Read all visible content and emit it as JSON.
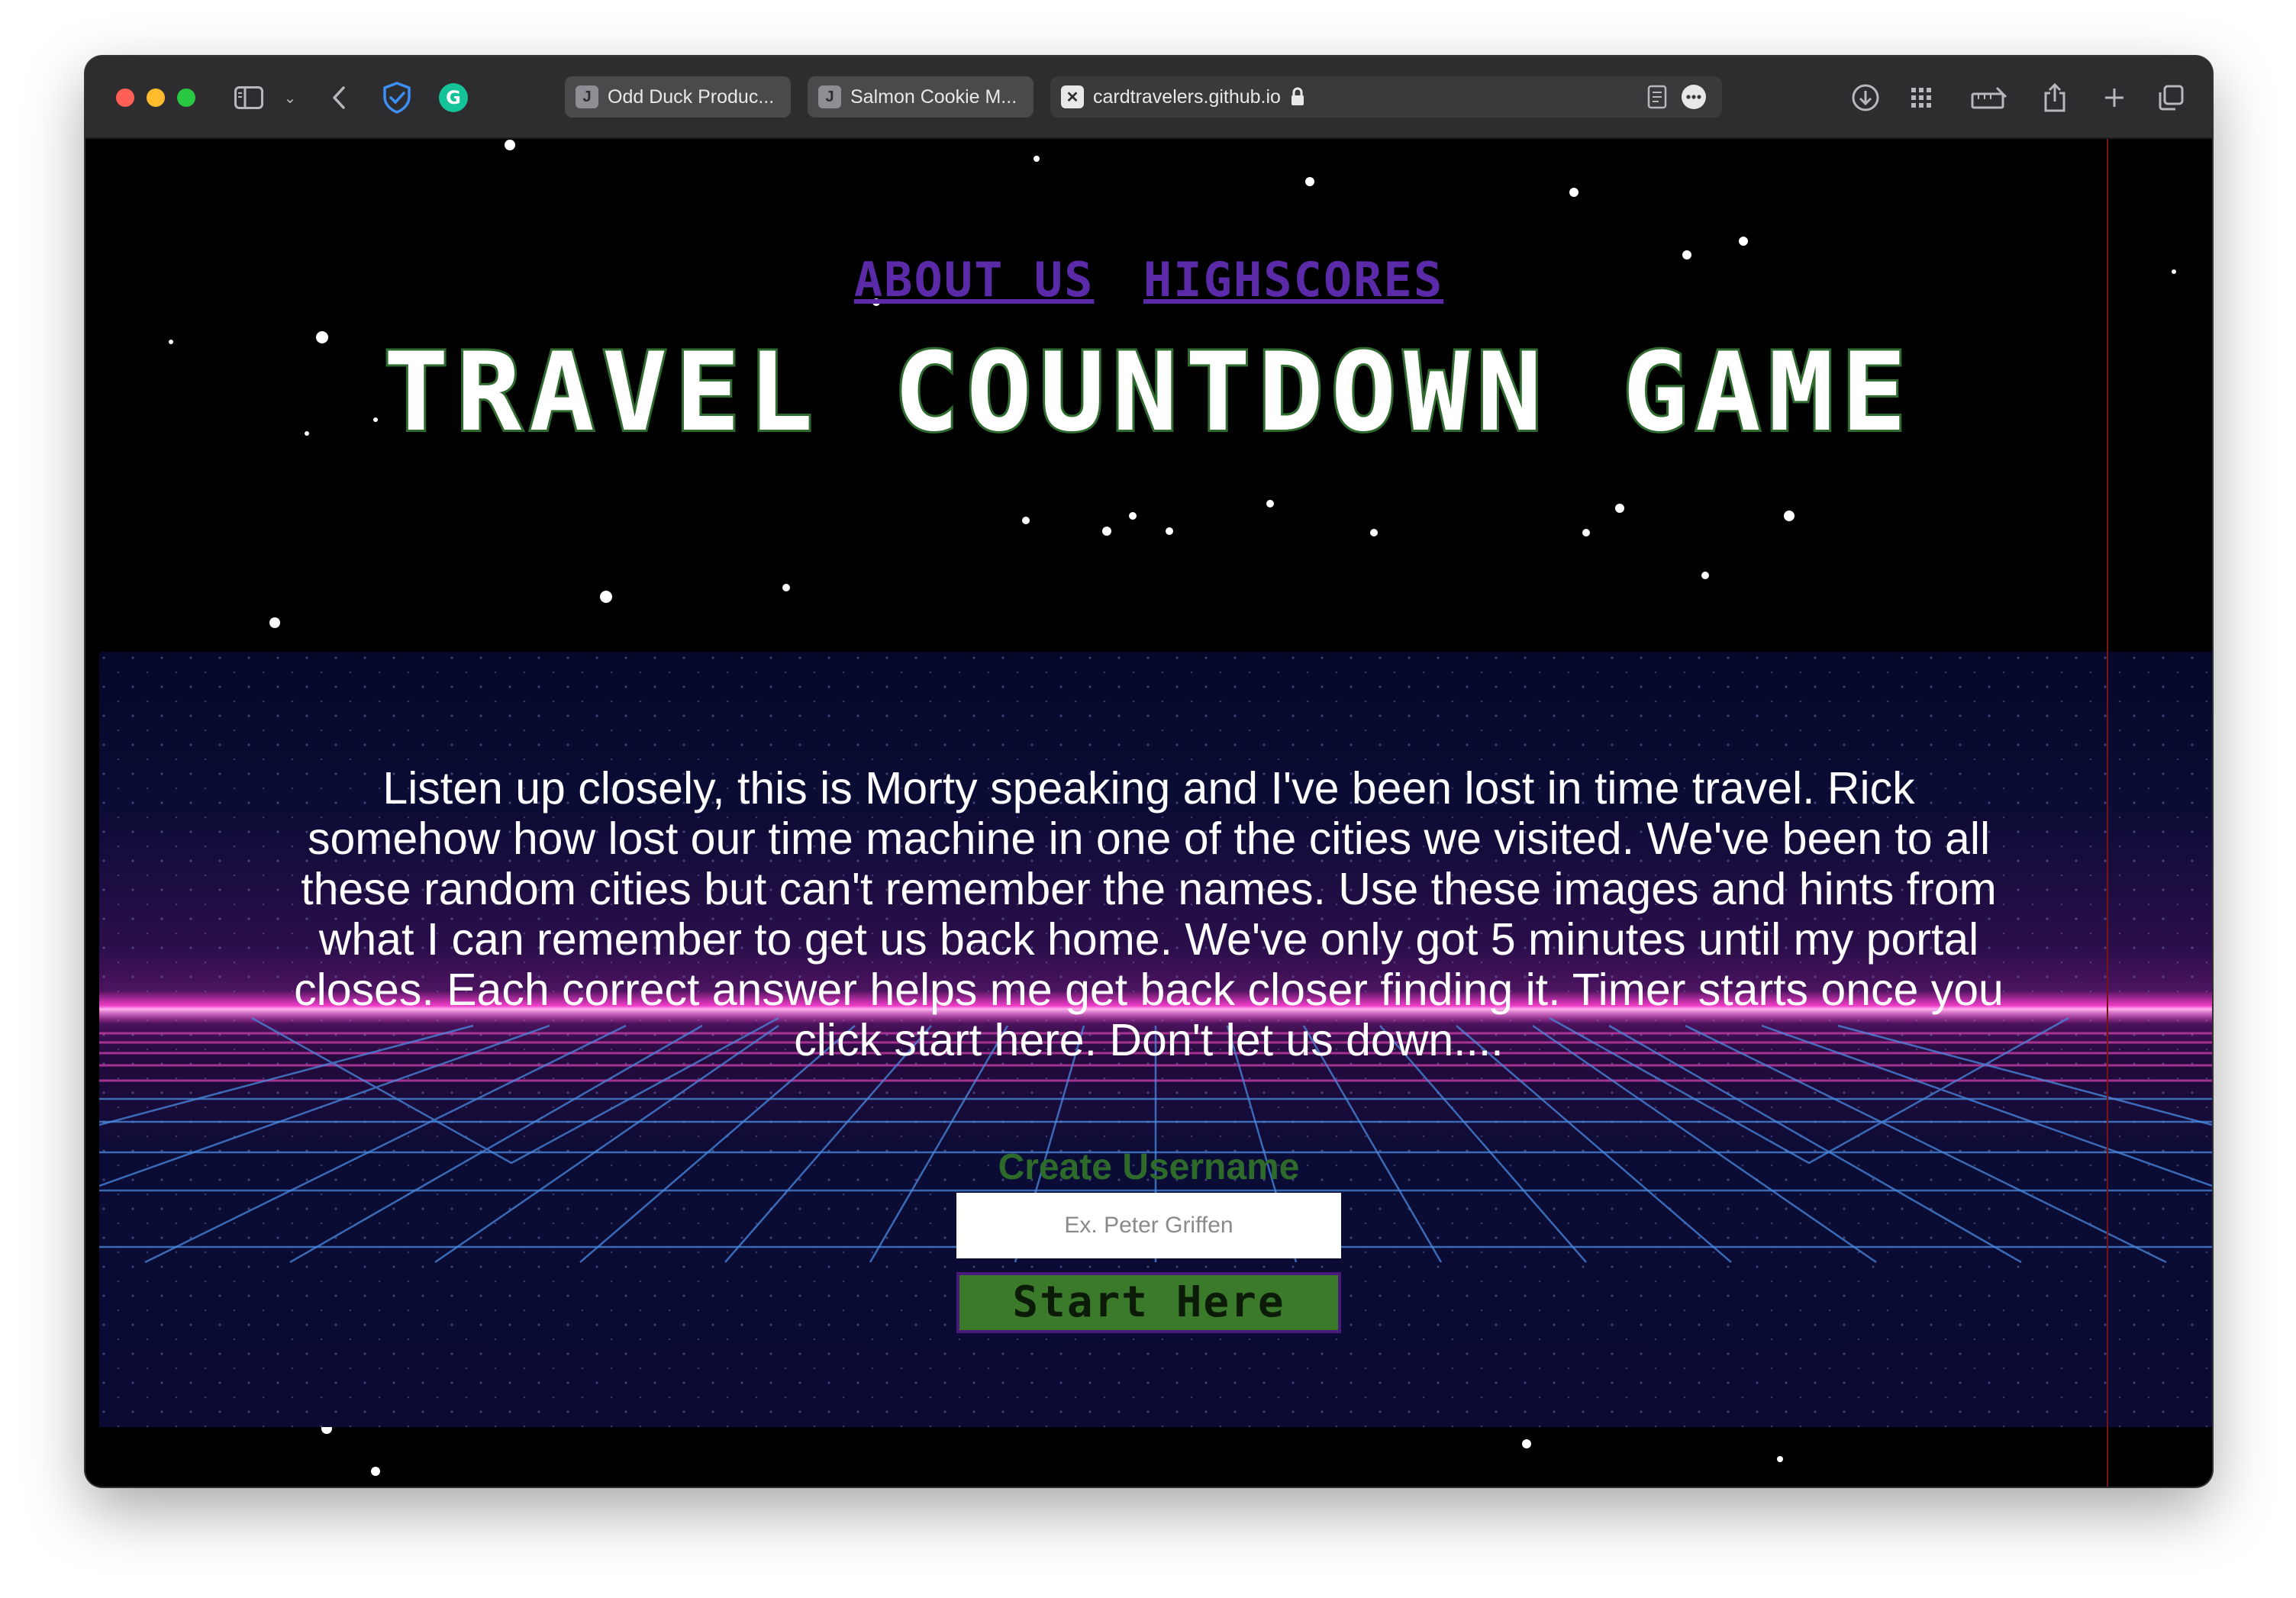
{
  "browser": {
    "tabs": [
      {
        "favicon": "J",
        "label": "Odd Duck Produc..."
      },
      {
        "favicon": "J",
        "label": "Salmon Cookie M..."
      }
    ],
    "address": {
      "favicon": "x-square-icon",
      "url": "cardtravelers.github.io"
    }
  },
  "nav": {
    "about_label": "ABOUT US",
    "highscores_label": "HIGHSCORES"
  },
  "page": {
    "title": "TRAVEL COUNTDOWN GAME",
    "story": "Listen up closely, this is Morty speaking and I've been lost in time travel. Rick somehow how lost our time machine in one of the cities we visited. We've been to all these random cities but can't remember the names. Use these images and hints from what I can remember to get us back home. We've only got 5 minutes until my portal closes. Each correct answer helps me get back closer finding it. Timer starts once you click start here. Don't let us down....",
    "form": {
      "username_label": "Create Username",
      "username_placeholder": "Ex. Peter Griffen",
      "username_value": "",
      "start_label": "Start Here"
    }
  },
  "colors": {
    "nav_link": "#5a2aa8",
    "title_outline": "#2f6b2f",
    "label_green": "#2e6b2a",
    "button_green": "#3b7a2a",
    "horizon_pink": "#ff3fd0",
    "grid_blue": "#3a78d8"
  }
}
